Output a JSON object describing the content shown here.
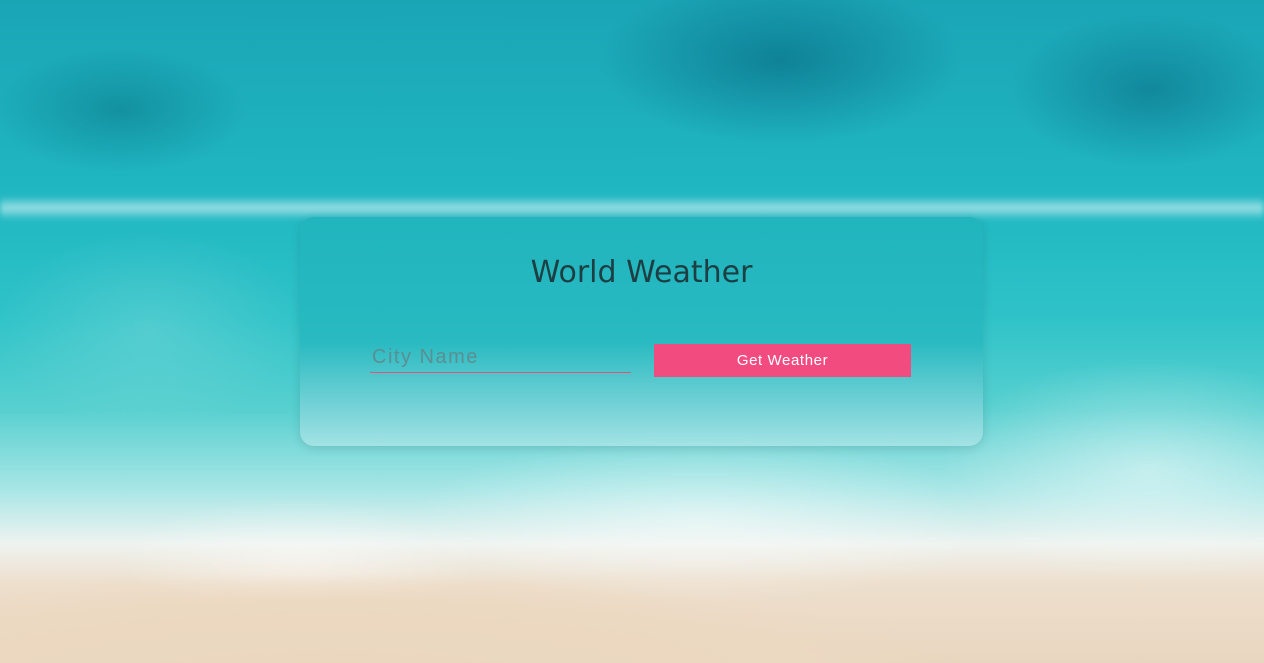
{
  "app": {
    "title": "World Weather"
  },
  "search": {
    "placeholder": "City Name",
    "value": ""
  },
  "actions": {
    "get_weather_label": "Get Weather"
  },
  "colors": {
    "accent": "#f24b7f",
    "title_text": "#1d3f44",
    "card": "#20b4be"
  }
}
